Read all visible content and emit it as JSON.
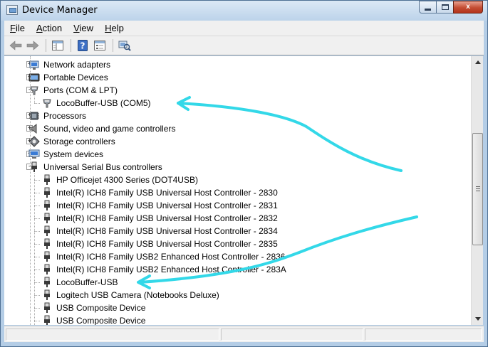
{
  "window": {
    "title": "Device Manager",
    "icon": "device-manager-icon"
  },
  "caption_buttons": [
    {
      "name": "minimize-button",
      "icon": "minimize-icon"
    },
    {
      "name": "maximize-button",
      "icon": "maximize-icon"
    },
    {
      "name": "close-button",
      "label": "x",
      "icon": "close-icon"
    }
  ],
  "menu": [
    {
      "label": "File",
      "accel": "F",
      "rest": "ile"
    },
    {
      "label": "Action",
      "accel": "A",
      "rest": "ction"
    },
    {
      "label": "View",
      "accel": "V",
      "rest": "iew"
    },
    {
      "label": "Help",
      "accel": "H",
      "rest": "elp"
    }
  ],
  "toolbar": [
    {
      "name": "back-button",
      "icon": "back-arrow-icon"
    },
    {
      "name": "forward-button",
      "icon": "forward-arrow-icon"
    },
    {
      "name": "show-hide-tree-button",
      "icon": "console-tree-icon"
    },
    {
      "name": "help-button",
      "icon": "help-icon"
    },
    {
      "name": "properties-button",
      "icon": "properties-icon"
    },
    {
      "name": "scan-hardware-button",
      "icon": "scan-hardware-icon"
    }
  ],
  "tree": [
    {
      "label": "Network adapters",
      "level": 1,
      "expander": "+",
      "icon": "network-adapter-icon"
    },
    {
      "label": "Portable Devices",
      "level": 1,
      "expander": "+",
      "icon": "portable-device-icon"
    },
    {
      "label": "Ports (COM & LPT)",
      "level": 1,
      "expander": "-",
      "icon": "port-icon"
    },
    {
      "label": "LocoBuffer-USB (COM5)",
      "level": 2,
      "expander": "",
      "icon": "port-icon"
    },
    {
      "label": "Processors",
      "level": 1,
      "expander": "+",
      "icon": "processor-icon"
    },
    {
      "label": "Sound, video and game controllers",
      "level": 1,
      "expander": "+",
      "icon": "speaker-icon"
    },
    {
      "label": "Storage controllers",
      "level": 1,
      "expander": "+",
      "icon": "storage-controller-icon"
    },
    {
      "label": "System devices",
      "level": 1,
      "expander": "+",
      "icon": "system-device-icon"
    },
    {
      "label": "Universal Serial Bus controllers",
      "level": 1,
      "expander": "-",
      "icon": "usb-icon"
    },
    {
      "label": "HP Officejet 4300 Series (DOT4USB)",
      "level": 2,
      "expander": "",
      "icon": "usb-icon"
    },
    {
      "label": "Intel(R) ICH8 Family USB Universal Host Controller - 2830",
      "level": 2,
      "expander": "",
      "icon": "usb-icon"
    },
    {
      "label": "Intel(R) ICH8 Family USB Universal Host Controller - 2831",
      "level": 2,
      "expander": "",
      "icon": "usb-icon"
    },
    {
      "label": "Intel(R) ICH8 Family USB Universal Host Controller - 2832",
      "level": 2,
      "expander": "",
      "icon": "usb-icon"
    },
    {
      "label": "Intel(R) ICH8 Family USB Universal Host Controller - 2834",
      "level": 2,
      "expander": "",
      "icon": "usb-icon"
    },
    {
      "label": "Intel(R) ICH8 Family USB Universal Host Controller - 2835",
      "level": 2,
      "expander": "",
      "icon": "usb-icon"
    },
    {
      "label": "Intel(R) ICH8 Family USB2 Enhanced Host Controller - 2836",
      "level": 2,
      "expander": "",
      "icon": "usb-icon"
    },
    {
      "label": "Intel(R) ICH8 Family USB2 Enhanced Host Controller - 283A",
      "level": 2,
      "expander": "",
      "icon": "usb-icon"
    },
    {
      "label": "LocoBuffer-USB",
      "level": 2,
      "expander": "",
      "icon": "usb-icon"
    },
    {
      "label": "Logitech USB Camera (Notebooks Deluxe)",
      "level": 2,
      "expander": "",
      "icon": "usb-icon"
    },
    {
      "label": "USB Composite Device",
      "level": 2,
      "expander": "",
      "icon": "usb-icon"
    },
    {
      "label": "USB Composite Device",
      "level": 2,
      "expander": "",
      "icon": "usb-icon"
    }
  ],
  "annotations": {
    "arrow_color": "#33d8e8"
  },
  "colors": {
    "selection_accent": "#33d8e8",
    "window_frame": "#b4cde6"
  }
}
